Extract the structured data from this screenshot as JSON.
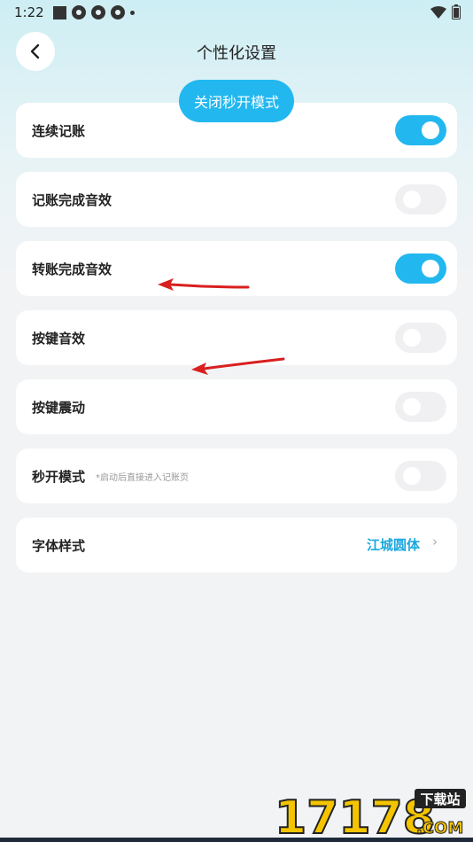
{
  "status": {
    "time": "1:22"
  },
  "header": {
    "title": "个性化设置"
  },
  "toast": {
    "text": "关闭秒开模式"
  },
  "rows": [
    {
      "label": "连续记账",
      "on": true
    },
    {
      "label": "记账完成音效",
      "on": false
    },
    {
      "label": "转账完成音效",
      "on": true
    },
    {
      "label": "按键音效",
      "on": false
    },
    {
      "label": "按键震动",
      "on": false
    },
    {
      "label": "秒开模式",
      "hint": "*启动后直接进入记账页",
      "on": false
    },
    {
      "label": "字体样式",
      "value": "江城圆体"
    }
  ],
  "colors": {
    "accent": "#22b8ef",
    "arrow": "#d91f1f"
  },
  "watermark": {
    "text": "17178",
    "badge": "下载站",
    "suffix": ".COM"
  }
}
